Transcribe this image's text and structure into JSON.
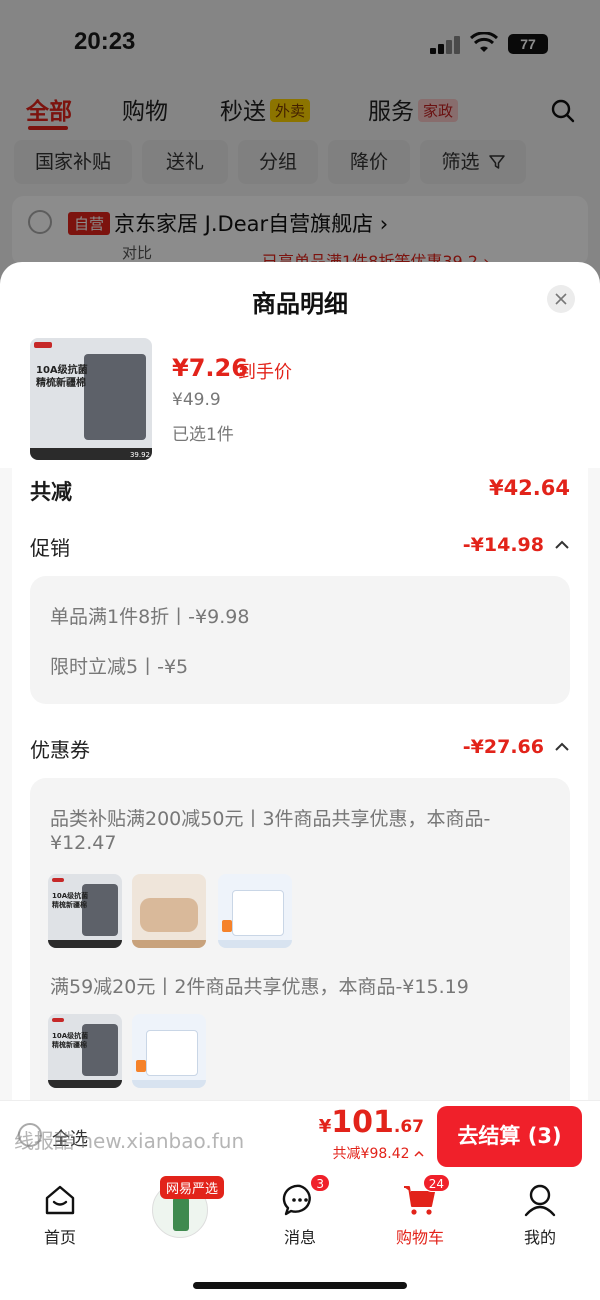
{
  "status_bar": {
    "time": "20:23",
    "battery": "77"
  },
  "top_tabs": [
    {
      "label": "全部"
    },
    {
      "label": "购物"
    },
    {
      "label": "秒送",
      "tag": "外卖"
    },
    {
      "label": "服务",
      "tag": "家政"
    }
  ],
  "filters": [
    "国家补贴",
    "送礼",
    "分组",
    "降价",
    "筛选"
  ],
  "shop": {
    "tag": "自营",
    "name": "京东家居 J.Dear自营旗舰店 ›",
    "sub": "已享单品满1件8折等优惠39.2 ›",
    "compare": "对比"
  },
  "sheet": {
    "title": "商品明细",
    "product": {
      "thumb_text": "10A级抗菌\n精梳新疆棉",
      "thumb_price": "39.92",
      "price": "¥7.26",
      "price_tag": "到手价",
      "original_price": "¥49.9",
      "selected": "已选1件"
    },
    "total_label": "共减",
    "total_value": "¥42.64",
    "promo": {
      "label": "促销",
      "value": "-¥14.98",
      "lines": [
        "单品满1件8折丨-¥9.98",
        "限时立减5丨-¥5"
      ]
    },
    "coupon": {
      "label": "优惠券",
      "value": "-¥27.66",
      "groups": [
        {
          "line1": "品类补贴满200减50元丨3件商品共享优惠，本商品-",
          "line2": "¥12.47"
        },
        {
          "line1": "满59减20元丨2件商品共享优惠，本商品-¥15.19",
          "line2": ""
        }
      ]
    }
  },
  "checkout": {
    "select_all": "全选",
    "watermark": "线报酷 new.xianbao.fun",
    "yen": "¥",
    "price_int": "101",
    "price_dec": ".67",
    "saved": "共减¥98.42",
    "button": "去结算 (3)"
  },
  "tabbar": [
    {
      "label": "首页"
    },
    {
      "label": "网易严选"
    },
    {
      "label": "消息",
      "badge": "3"
    },
    {
      "label": "购物车",
      "badge": "24"
    },
    {
      "label": "我的"
    }
  ],
  "colors": {
    "accent": "#e2231a",
    "checkout": "#f0202a"
  }
}
